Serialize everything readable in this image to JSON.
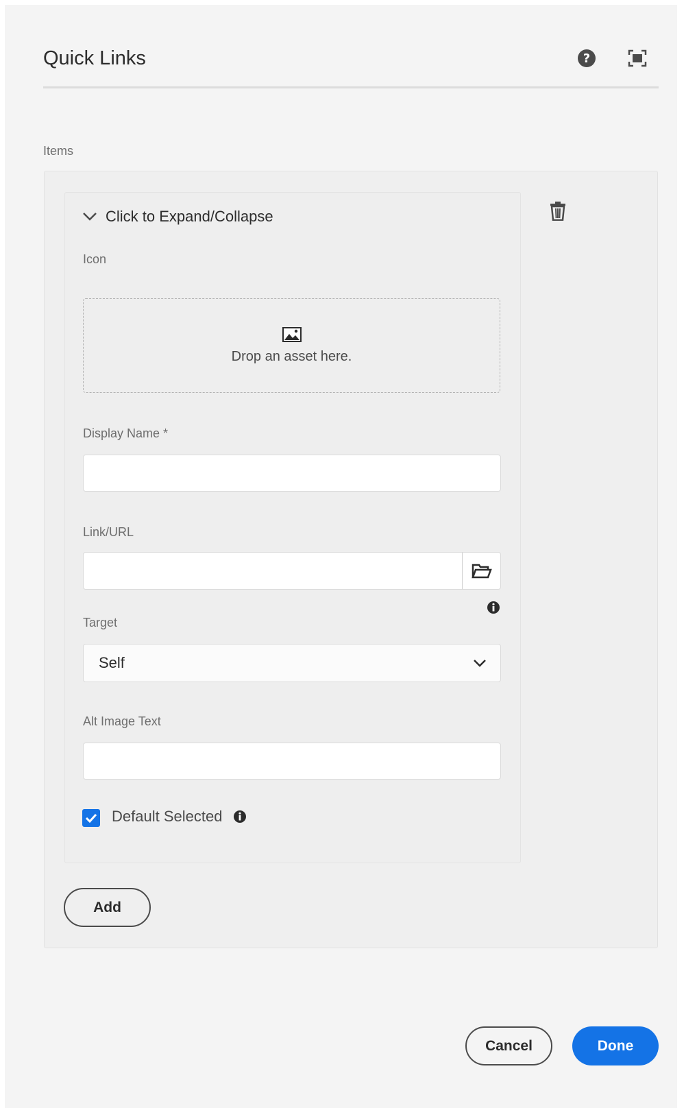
{
  "dialog": {
    "title": "Quick Links",
    "help_icon": "help-icon",
    "fullscreen_icon": "fullscreen-icon"
  },
  "items": {
    "label": "Items",
    "item": {
      "expander_label": "Click to Expand/Collapse",
      "icon_field": {
        "label": "Icon",
        "dropzone_text": "Drop an asset here."
      },
      "display_name": {
        "label": "Display Name *",
        "value": ""
      },
      "link_url": {
        "label": "Link/URL",
        "value": ""
      },
      "target": {
        "label": "Target",
        "selected": "Self"
      },
      "alt_image_text": {
        "label": "Alt Image Text",
        "value": ""
      },
      "default_selected": {
        "label": "Default Selected",
        "checked": true
      }
    },
    "add_label": "Add"
  },
  "footer": {
    "cancel_label": "Cancel",
    "done_label": "Done"
  },
  "colors": {
    "accent": "#1473e6",
    "background": "#f4f4f4"
  }
}
